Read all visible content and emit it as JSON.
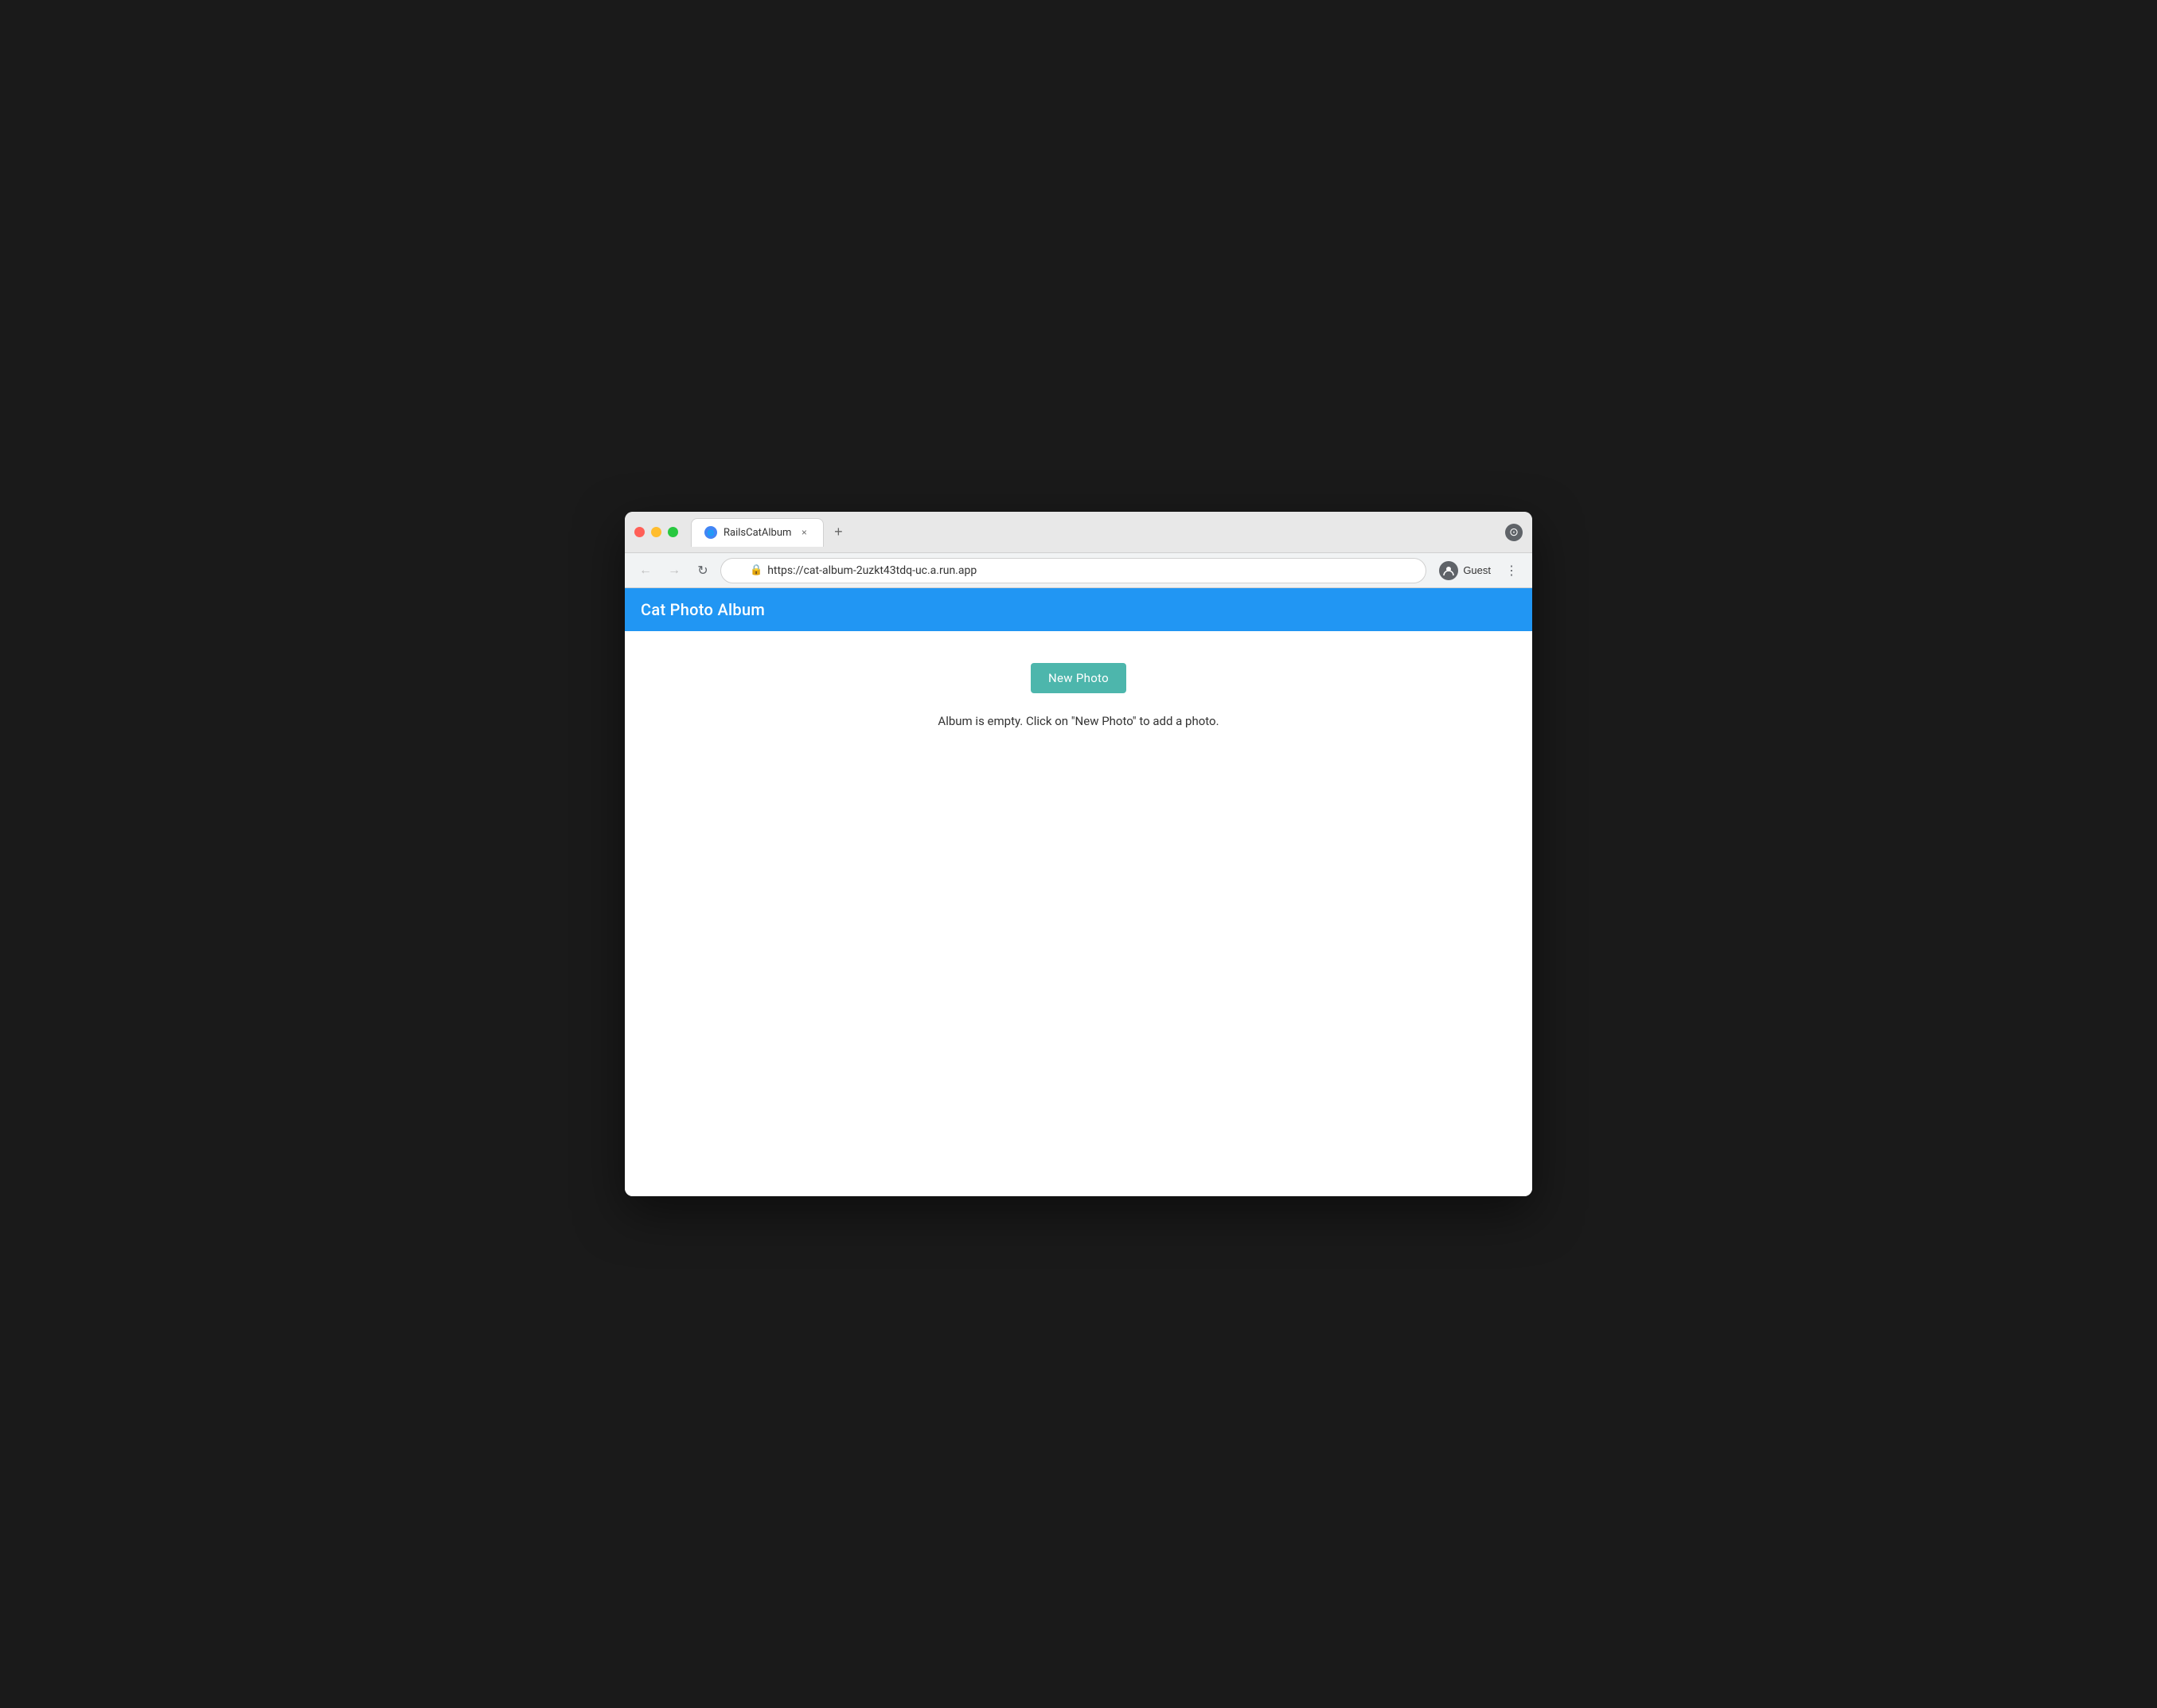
{
  "browser": {
    "tab_title": "RailsCatAlbum",
    "tab_close": "×",
    "tab_new": "+",
    "url": "https://cat-album-2uzkt43tdq-uc.a.run.app",
    "nav": {
      "back": "←",
      "forward": "→",
      "reload": "↻"
    },
    "user_label": "Guest",
    "more_icon": "⋮"
  },
  "app": {
    "title": "Cat Photo Album",
    "new_photo_button": "New Photo",
    "empty_message": "Album is empty. Click on \"New Photo\" to add a photo."
  }
}
